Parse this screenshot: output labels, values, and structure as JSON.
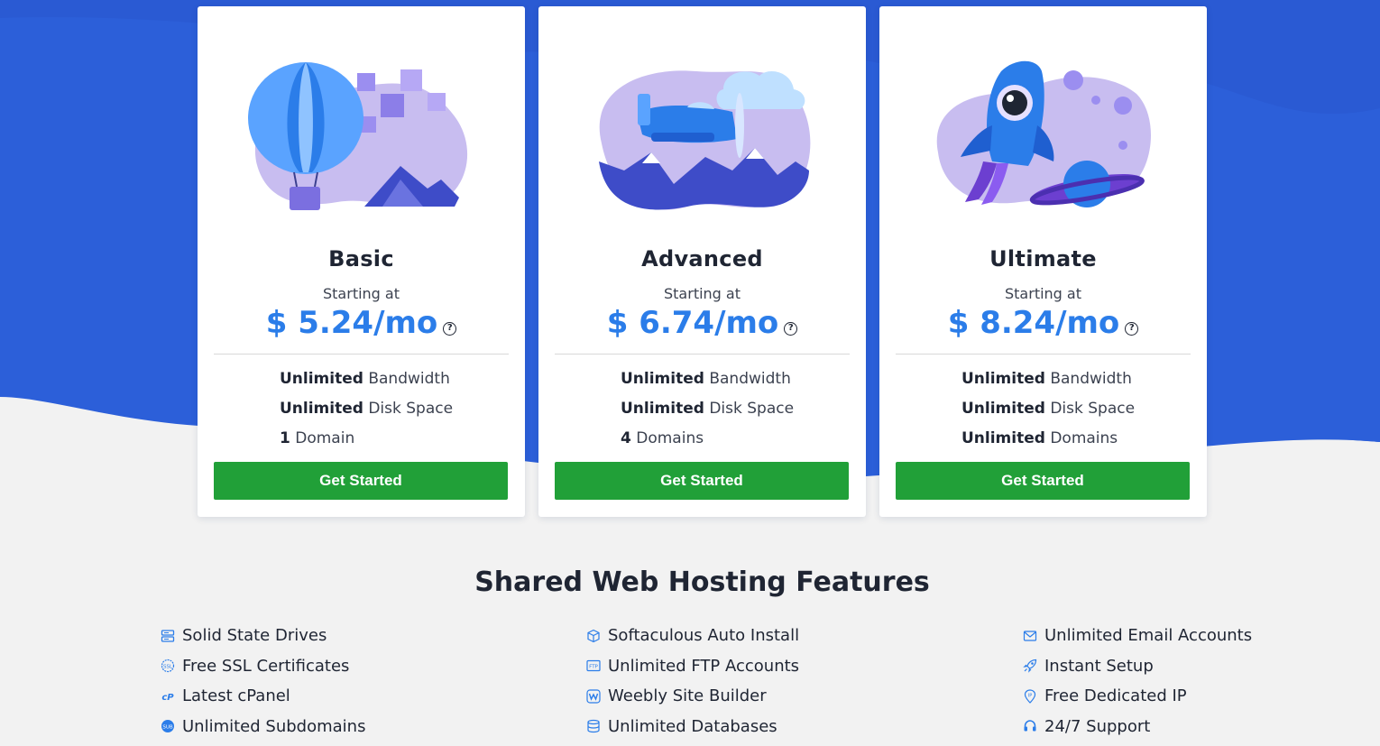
{
  "plans": [
    {
      "name": "Basic",
      "starting": "Starting at",
      "price": "$ 5.24/mo",
      "f1_bold": "Unlimited",
      "f1_rest": " Bandwidth",
      "f2_bold": "Unlimited",
      "f2_rest": " Disk Space",
      "f3_bold": "1",
      "f3_rest": " Domain",
      "cta": "Get Started",
      "illustration": "hot-air-balloon"
    },
    {
      "name": "Advanced",
      "starting": "Starting at",
      "price": "$ 6.74/mo",
      "f1_bold": "Unlimited",
      "f1_rest": " Bandwidth",
      "f2_bold": "Unlimited",
      "f2_rest": " Disk Space",
      "f3_bold": "4",
      "f3_rest": " Domains",
      "cta": "Get Started",
      "illustration": "airplane"
    },
    {
      "name": "Ultimate",
      "starting": "Starting at",
      "price": "$ 8.24/mo",
      "f1_bold": "Unlimited",
      "f1_rest": " Bandwidth",
      "f2_bold": "Unlimited",
      "f2_rest": " Disk Space",
      "f3_bold": "Unlimited",
      "f3_rest": " Domains",
      "cta": "Get Started",
      "illustration": "rocket"
    }
  ],
  "help_icon_glyph": "?",
  "features_section": {
    "title": "Shared Web Hosting Features",
    "columns": [
      [
        {
          "label": "Solid State Drives",
          "icon": "server-icon"
        },
        {
          "label": "Free SSL Certificates",
          "icon": "ssl-icon"
        },
        {
          "label": "Latest cPanel",
          "icon": "cpanel-icon"
        },
        {
          "label": "Unlimited Subdomains",
          "icon": "subdomain-icon"
        }
      ],
      [
        {
          "label": "Softaculous Auto Install",
          "icon": "cube-icon"
        },
        {
          "label": "Unlimited FTP Accounts",
          "icon": "ftp-icon"
        },
        {
          "label": "Weebly Site Builder",
          "icon": "weebly-icon"
        },
        {
          "label": "Unlimited Databases",
          "icon": "database-icon"
        }
      ],
      [
        {
          "label": "Unlimited Email Accounts",
          "icon": "envelope-icon"
        },
        {
          "label": "Instant Setup",
          "icon": "rocket-icon"
        },
        {
          "label": "Free Dedicated IP",
          "icon": "ip-icon"
        },
        {
          "label": "24/7 Support",
          "icon": "headset-icon"
        }
      ]
    ]
  },
  "colors": {
    "hero_blue": "#2c5fd9",
    "price_blue": "#2b7de9",
    "cta_green": "#21a038",
    "icon_blue": "#2b7de9"
  }
}
